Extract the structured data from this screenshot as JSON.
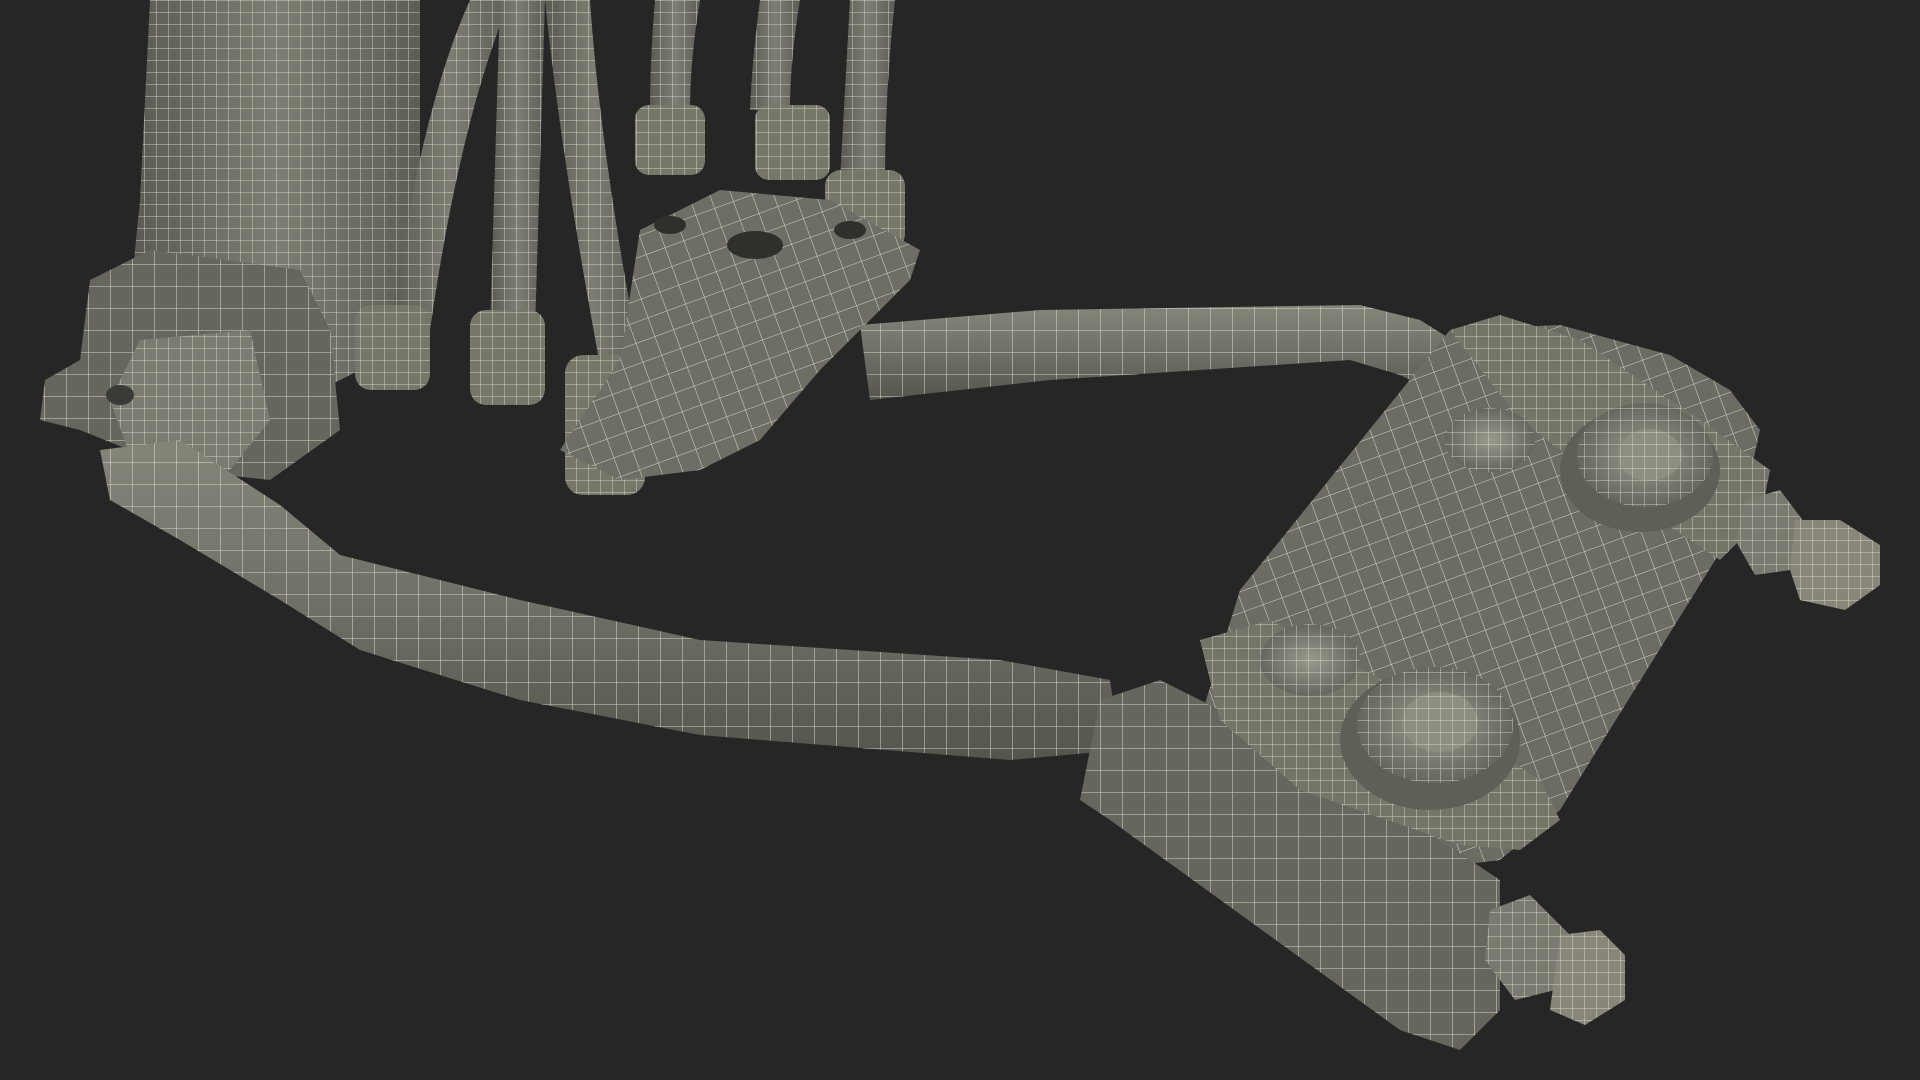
{
  "scene": {
    "subject": "wireframe-3d-model",
    "background_color": "#262626",
    "mesh_fill_color": "#6f6f66",
    "mesh_shadow_color": "#4c4c46",
    "mesh_highlight_color": "#8a8a80",
    "wire_color": "#e6e4d6"
  }
}
